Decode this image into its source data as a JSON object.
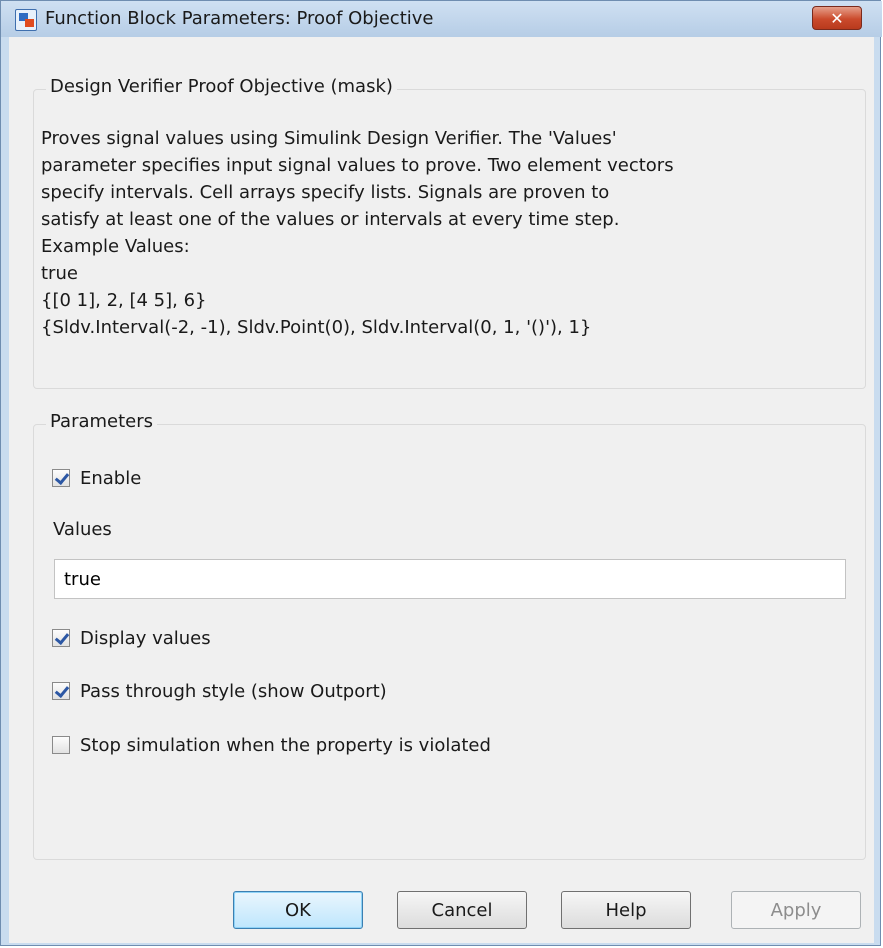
{
  "window": {
    "title": "Function Block Parameters: Proof Objective",
    "close_label": "✕"
  },
  "mask_group": {
    "title": "Design Verifier Proof Objective (mask)",
    "description_lines": [
      "Proves signal values using Simulink Design Verifier.  The 'Values'",
      "parameter specifies input signal values to prove. Two element vectors",
      "specify intervals.  Cell arrays specify lists. Signals are proven to",
      "satisfy at least one of the values or intervals at every time step.",
      "Example Values:",
      "true",
      "{[0 1], 2, [4 5], 6}",
      "{Sldv.Interval(-2, -1), Sldv.Point(0), Sldv.Interval(0, 1, '()'), 1}"
    ]
  },
  "parameters": {
    "title": "Parameters",
    "enable": {
      "label": "Enable",
      "checked": true
    },
    "values": {
      "label": "Values",
      "value": "true"
    },
    "display_values": {
      "label": "Display values",
      "checked": true
    },
    "pass_through": {
      "label": "Pass through style (show Outport)",
      "checked": true
    },
    "stop_simulation": {
      "label": "Stop simulation when the property is violated",
      "checked": false
    }
  },
  "buttons": {
    "ok": "OK",
    "cancel": "Cancel",
    "help": "Help",
    "apply": "Apply"
  }
}
